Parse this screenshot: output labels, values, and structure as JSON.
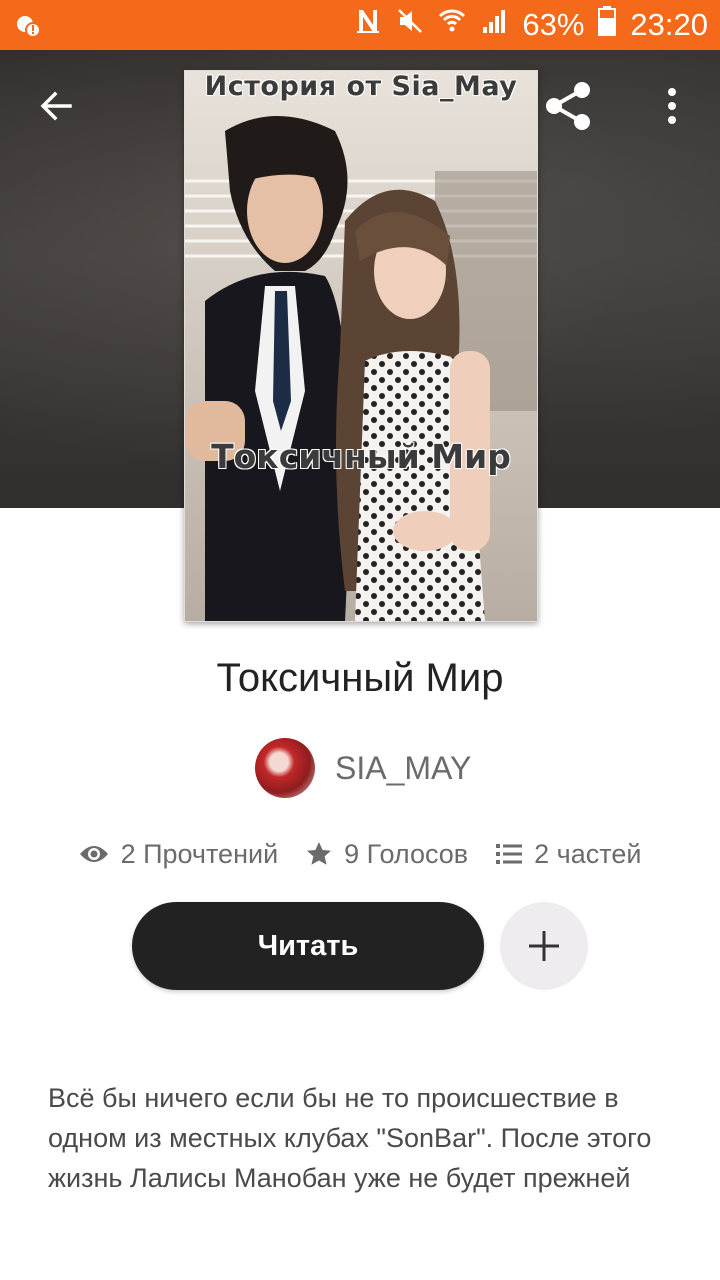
{
  "status_bar": {
    "battery": "63%",
    "time": "23:20",
    "icons": [
      "notification-icon",
      "nfc-icon",
      "mute-icon",
      "wifi-icon",
      "signal-icon",
      "battery-icon"
    ]
  },
  "header": {
    "icons": [
      "back-arrow-icon",
      "share-icon",
      "more-vert-icon"
    ]
  },
  "cover": {
    "top_text": "История от Sia_May",
    "title_text": "Токсичный Мир"
  },
  "story": {
    "title": "Токсичный Мир",
    "author": "SIA_MAY",
    "reads": "2 Прочтений",
    "votes": "9 Голосов",
    "parts": "2 частей",
    "read_label": "Читать",
    "description": "Всё бы ничего если бы не то происшествие в одном из местных клубах \"SonBar\". После этого жизнь Лалисы Манобан уже не будет прежней"
  },
  "colors": {
    "status_bar": "#f46a1a",
    "read_button": "#232223",
    "add_button": "#eeecee"
  }
}
